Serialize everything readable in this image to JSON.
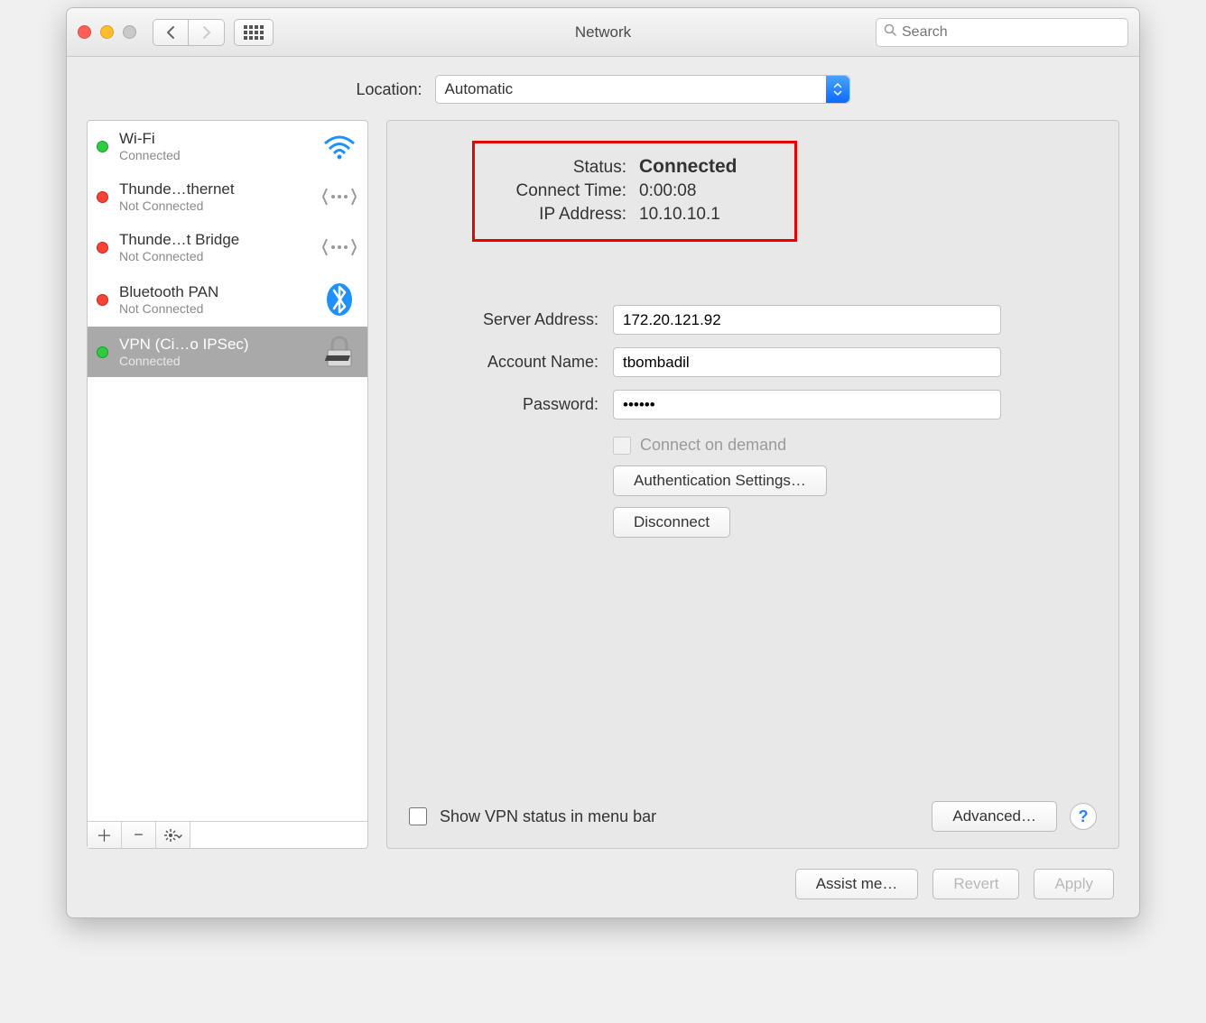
{
  "window": {
    "title": "Network",
    "search_placeholder": "Search"
  },
  "location": {
    "label": "Location:",
    "value": "Automatic"
  },
  "interfaces": [
    {
      "name": "Wi-Fi",
      "status": "Connected",
      "dot": "green",
      "icon": "wifi",
      "selected": false
    },
    {
      "name": "Thunde…thernet",
      "status": "Not Connected",
      "dot": "red",
      "icon": "eth",
      "selected": false
    },
    {
      "name": "Thunde…t Bridge",
      "status": "Not Connected",
      "dot": "red",
      "icon": "eth",
      "selected": false
    },
    {
      "name": "Bluetooth PAN",
      "status": "Not Connected",
      "dot": "red",
      "icon": "bt",
      "selected": false
    },
    {
      "name": "VPN (Ci…o IPSec)",
      "status": "Connected",
      "dot": "green",
      "icon": "lock",
      "selected": true
    }
  ],
  "status": {
    "labels": {
      "status": "Status:",
      "connect_time": "Connect Time:",
      "ip": "IP Address:"
    },
    "value": "Connected",
    "connect_time": "0:00:08",
    "ip": "10.10.10.1"
  },
  "form": {
    "server_label": "Server Address:",
    "server_value": "172.20.121.92",
    "account_label": "Account Name:",
    "account_value": "tbombadil",
    "password_label": "Password:",
    "password_value": "••••••",
    "connect_on_demand": "Connect on demand",
    "auth_settings": "Authentication Settings…",
    "disconnect": "Disconnect"
  },
  "panel_bottom": {
    "show_vpn": "Show VPN status in menu bar",
    "advanced": "Advanced…"
  },
  "bottom": {
    "assist": "Assist me…",
    "revert": "Revert",
    "apply": "Apply"
  }
}
